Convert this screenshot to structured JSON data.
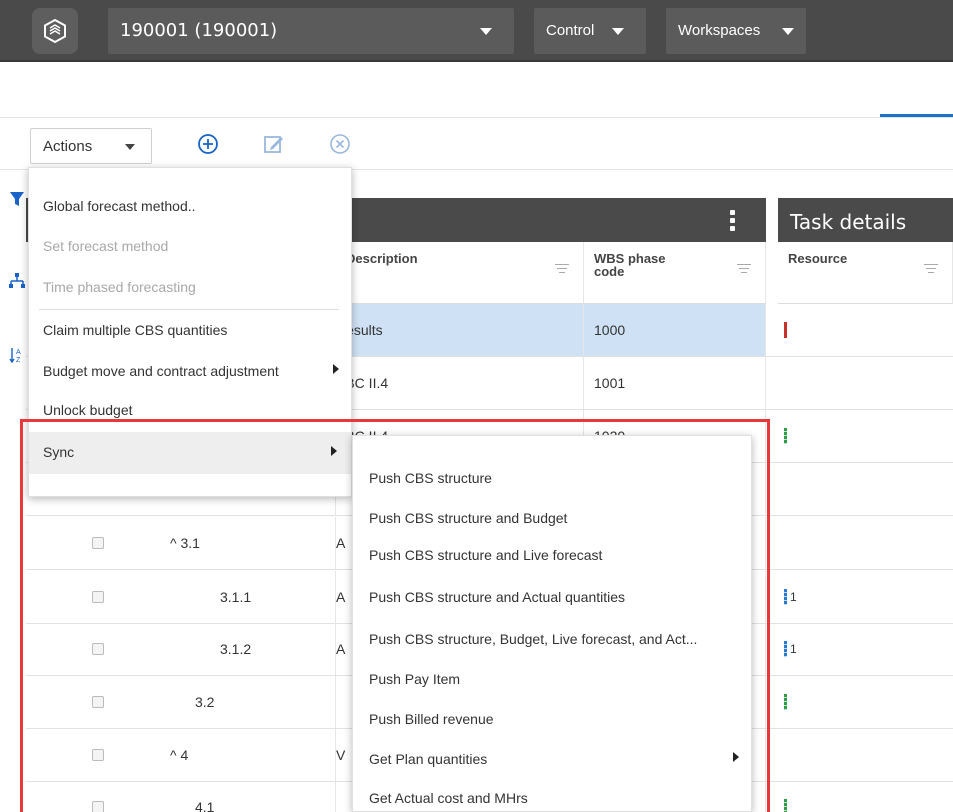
{
  "topbar": {
    "project_label": "190001 (190001)",
    "control_label": "Control",
    "workspaces_label": "Workspaces"
  },
  "toolbar": {
    "actions_label": "Actions",
    "icons": [
      "add-circle-icon",
      "edit-icon",
      "remove-circle-icon"
    ]
  },
  "grid": {
    "columns": [
      {
        "label": "Description"
      },
      {
        "label": "WBS phase code"
      }
    ],
    "task_details": {
      "title": "Task details",
      "resource_label": "Resource"
    },
    "rows": [
      {
        "code": "",
        "desc": "Results",
        "wbs": "1000",
        "resource_mark": "red",
        "resource_num": "",
        "selected": true
      },
      {
        "code": "",
        "desc": "ABC II.4",
        "wbs": "1001",
        "resource_mark": "",
        "resource_num": ""
      },
      {
        "code": "",
        "desc": "ABC II.4",
        "wbs": "1020",
        "resource_mark": "green",
        "resource_num": ""
      },
      {
        "code": "",
        "desc": "",
        "wbs": "",
        "resource_mark": "",
        "resource_num": ""
      },
      {
        "code": "^ 3.1",
        "desc": "A",
        "wbs": "",
        "resource_mark": "",
        "resource_num": ""
      },
      {
        "code": "3.1.1",
        "desc": "A",
        "wbs": "",
        "resource_mark": "blue",
        "resource_num": "1"
      },
      {
        "code": "3.1.2",
        "desc": "A",
        "wbs": "",
        "resource_mark": "blue",
        "resource_num": "1"
      },
      {
        "code": "3.2",
        "desc": "",
        "wbs": "",
        "resource_mark": "green",
        "resource_num": ""
      },
      {
        "code": "^ 4",
        "desc": "V",
        "wbs": "",
        "resource_mark": "",
        "resource_num": ""
      },
      {
        "code": "4.1",
        "desc": "",
        "wbs": "",
        "resource_mark": "green",
        "resource_num": ""
      }
    ]
  },
  "actions_menu": {
    "items": [
      {
        "label": "Global forecast method..",
        "disabled": false
      },
      {
        "label": "Set forecast method",
        "disabled": true
      },
      {
        "label": "Time phased forecasting",
        "disabled": true
      },
      {
        "label": "Claim multiple CBS quantities",
        "disabled": false
      },
      {
        "label": "Budget move and contract adjustment",
        "disabled": false
      },
      {
        "label": "Unlock budget",
        "disabled": false
      },
      {
        "label": "Sync",
        "disabled": false
      }
    ]
  },
  "sync_menu": {
    "items": [
      {
        "label": "Push CBS structure"
      },
      {
        "label": "Push CBS structure and Budget"
      },
      {
        "label": "Push CBS structure and Live forecast"
      },
      {
        "label": "Push CBS structure and Actual quantities"
      },
      {
        "label": "Push CBS structure, Budget, Live forecast, and Act..."
      },
      {
        "label": "Push Pay Item"
      },
      {
        "label": "Push Billed revenue"
      },
      {
        "label": "Get Plan quantities"
      },
      {
        "label": "Get Actual cost and MHrs"
      }
    ]
  },
  "colors": {
    "topbar": "#4a4a4a",
    "selected_row": "#cfe1f5",
    "highlight": "#e8383a",
    "accent": "#1a73c8"
  }
}
